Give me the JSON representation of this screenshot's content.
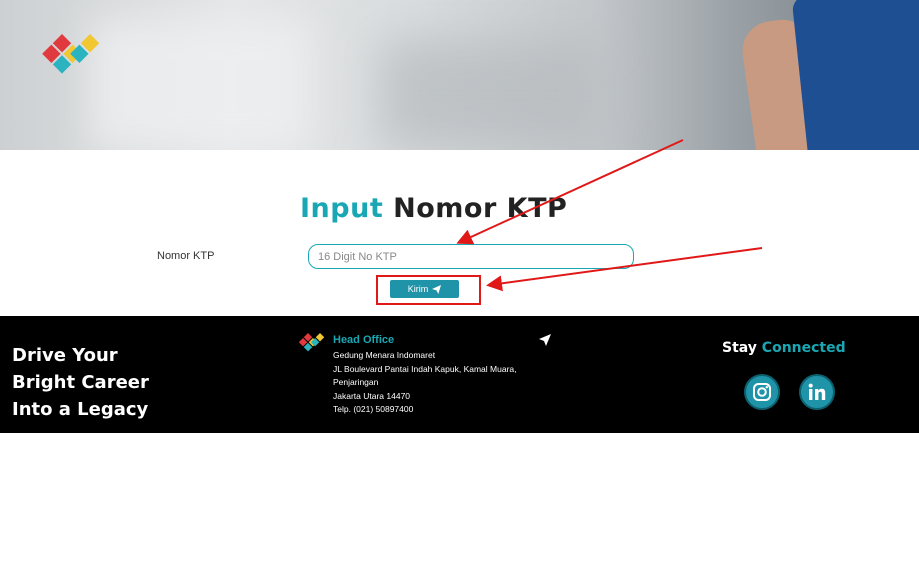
{
  "form": {
    "title_accent": "Input",
    "title_main": "Nomor KTP",
    "field_label": "Nomor KTP",
    "field_placeholder": "16 Digit No KTP",
    "submit_label": "Kirim"
  },
  "footer": {
    "tagline_lines": [
      "Drive Your",
      "Bright Career",
      "Into a Legacy"
    ],
    "office_title": "Head Office",
    "address_lines": [
      "Gedung Menara Indomaret",
      "JL Boulevard Pantai Indah Kapuk, Kamal Muara,",
      "Penjaringan",
      "Jakarta Utara 14470",
      "Telp. (021) 50897400"
    ],
    "stay_word": "Stay",
    "connected_word": "Connected",
    "social": [
      "instagram-icon",
      "linkedin-icon"
    ]
  },
  "colors": {
    "accent": "#1aa7b4",
    "button": "#1f93a8",
    "annotation": "#e01818",
    "footer_bg": "#000000"
  }
}
